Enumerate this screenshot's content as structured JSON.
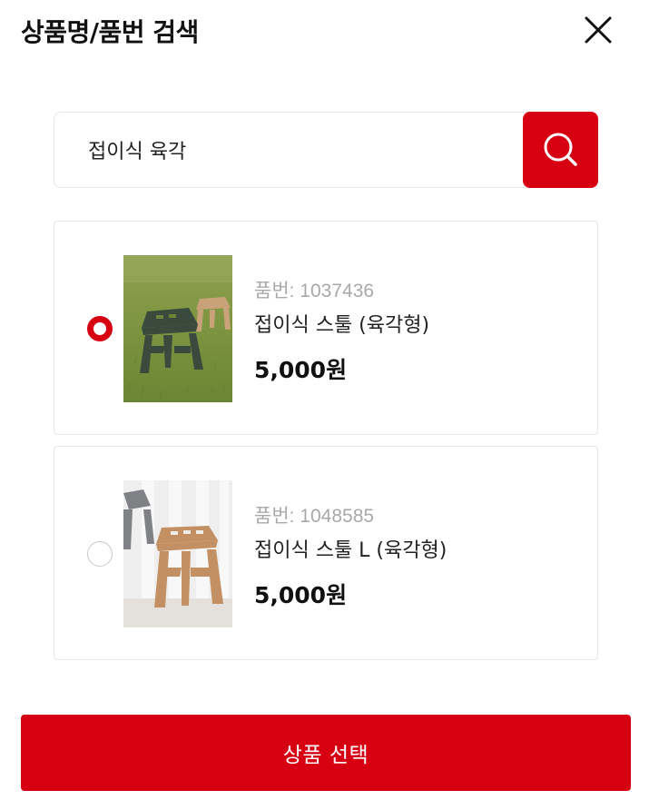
{
  "header": {
    "title": "상품명/품번 검색"
  },
  "search": {
    "value": "접이식 육각"
  },
  "products": [
    {
      "code": "품번: 1037436",
      "name": "접이식 스툴 (육각형)",
      "price": "5,000원",
      "selected": true
    },
    {
      "code": "품번: 1048585",
      "name": "접이식 스툴 L (육각형)",
      "price": "5,000원",
      "selected": false
    }
  ],
  "footer": {
    "select_label": "상품 선택"
  },
  "colors": {
    "accent": "#d70012"
  },
  "icons": {
    "close": "close-icon",
    "search": "search-icon",
    "radio": "radio-icon"
  }
}
